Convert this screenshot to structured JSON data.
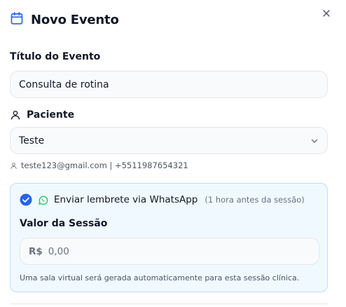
{
  "dialog": {
    "title": "Novo Evento",
    "title_icon": "calendar-icon",
    "close_icon": "close-icon"
  },
  "fields": {
    "event_title": {
      "label": "Título do Evento",
      "value": "Consulta de rotina"
    },
    "patient": {
      "label": "Paciente",
      "label_icon": "user-icon",
      "selected": "Teste",
      "contact": "teste123@gmail.com | +5511987654321"
    }
  },
  "reminder": {
    "checked": true,
    "text": "Enviar lembrete via WhatsApp",
    "hint": "(1 hora antes da sessão)",
    "colors": {
      "accent": "#2563eb",
      "whatsapp": "#22c55e"
    }
  },
  "session_value": {
    "label": "Valor da Sessão",
    "currency": "R$",
    "value": "0,00"
  },
  "note": "Uma sala virtual será gerada automaticamente para esta sessão clínica."
}
